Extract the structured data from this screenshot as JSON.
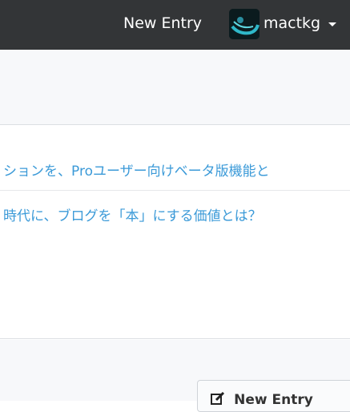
{
  "topbar": {
    "new_entry_label": "New Entry",
    "username": "mactkg",
    "background_color": "#333537",
    "icons": [
      "avatar",
      "caret-down-icon"
    ]
  },
  "news": {
    "items": [
      {
        "text": "ションを、Proユーザー向けベータ版機能と"
      },
      {
        "text": "時代に、ブログを「本」にする価値とは？"
      }
    ],
    "link_color": "#3b9ad8"
  },
  "bottom_button": {
    "label": "New Entry",
    "icon": "edit-icon"
  }
}
